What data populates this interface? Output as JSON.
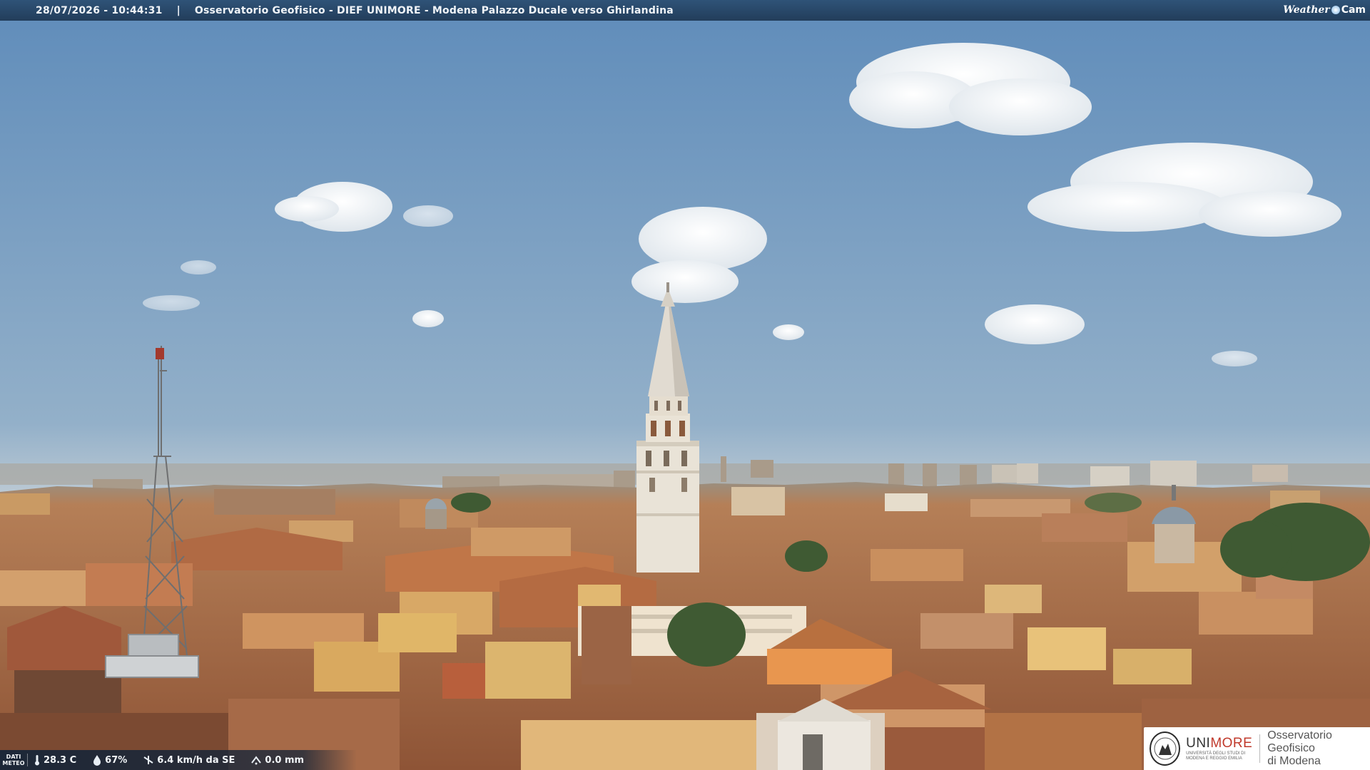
{
  "header": {
    "timestamp": "28/07/2026 - 10:44:31",
    "separator": "|",
    "title": "Osservatorio Geofisico - DIEF UNIMORE - Modena Palazzo Ducale verso Ghirlandina"
  },
  "brand": {
    "weather": "Weather",
    "cam": "Cam"
  },
  "weather_bar": {
    "label_line1": "DATI",
    "label_line2": "METEO",
    "temperature": "28.3 C",
    "humidity": "67%",
    "wind": "6.4 km/h da SE",
    "rain": "0.0 mm",
    "icons": [
      "thermometer-icon",
      "humidity-icon",
      "wind-icon",
      "rain-icon"
    ]
  },
  "logo": {
    "university": "UNIMORE",
    "university_prefix": "UNI",
    "university_suffix": "MORE",
    "university_sub1": "UNIVERSITÀ DEGLI STUDI DI",
    "university_sub2": "MODENA E REGGIO EMILIA",
    "observatory_line1": "Osservatorio Geofisico",
    "observatory_line2": "di Modena"
  },
  "colors": {
    "sky_top": "#6e98c2",
    "sky_horizon": "#b9c8d4",
    "roof": "#b8734a",
    "tower": "#ece6da",
    "header_bg": "#2a4a6d",
    "unimore_red": "#c0392b"
  }
}
